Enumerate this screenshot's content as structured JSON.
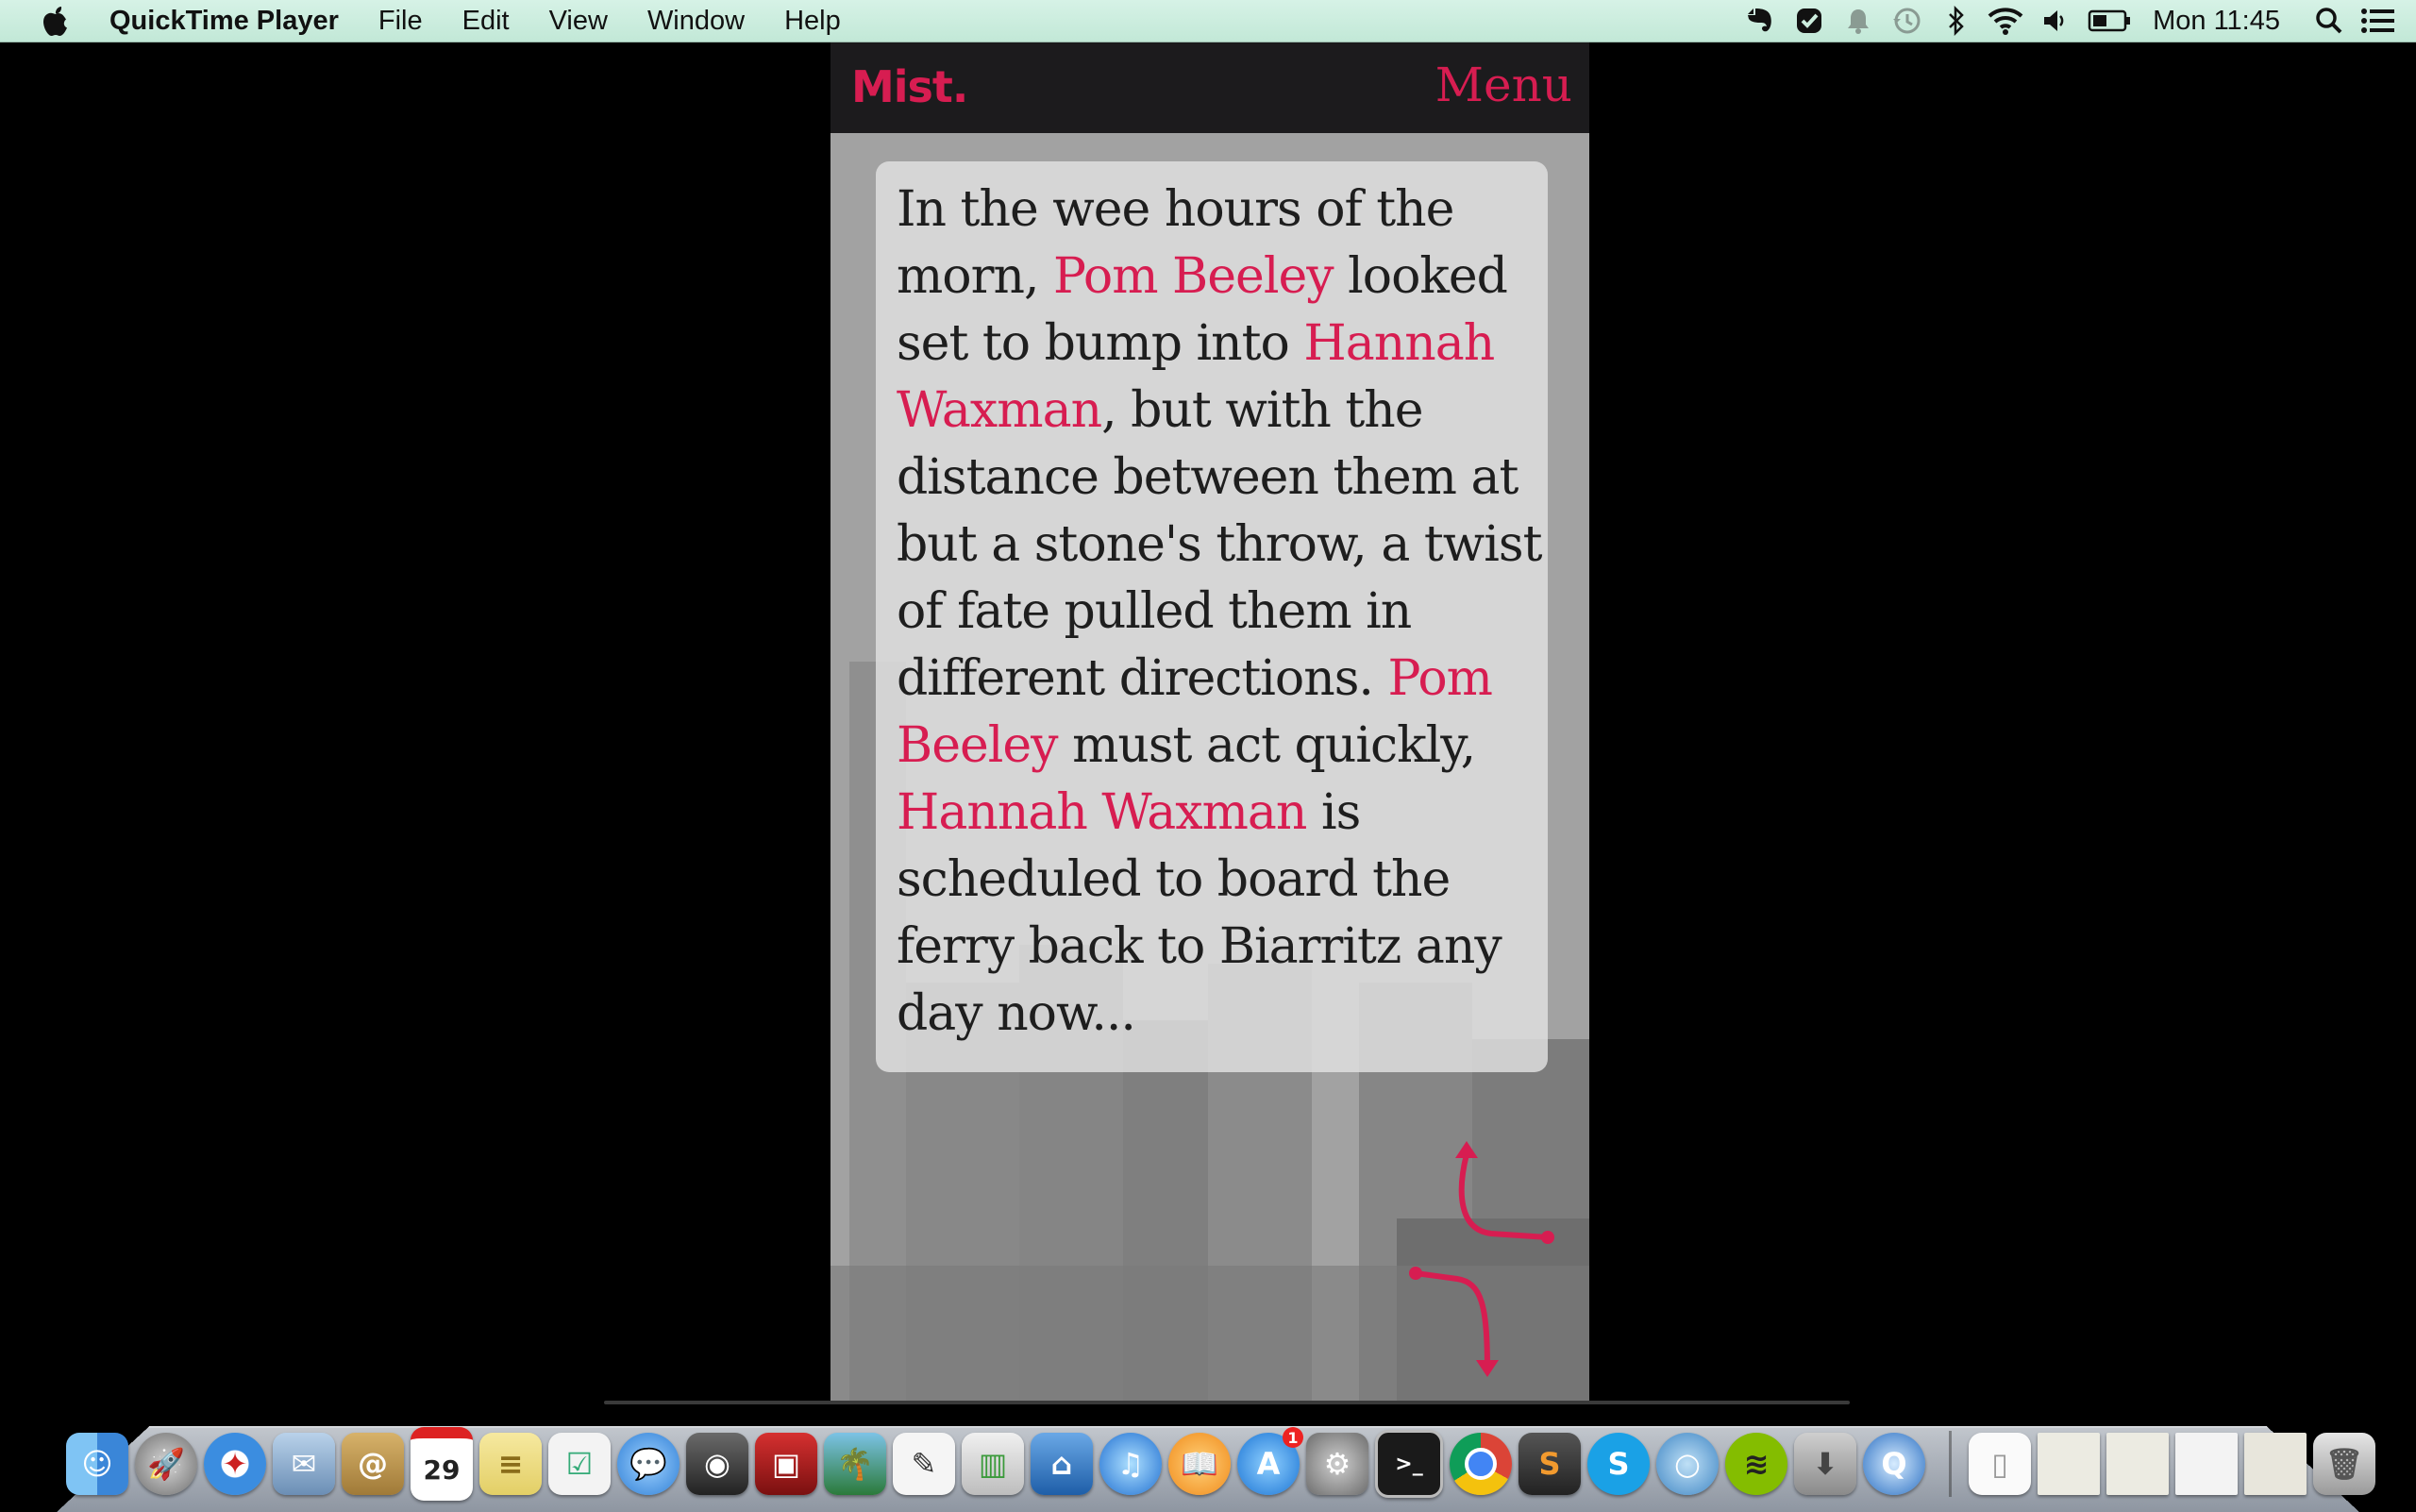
{
  "menubar": {
    "apple_icon": "apple-logo-icon",
    "app_name": "QuickTime Player",
    "menus": [
      "File",
      "Edit",
      "View",
      "Window",
      "Help"
    ],
    "status_icons": [
      "evernote-icon",
      "checkmark-badge-icon",
      "notification-bell-icon",
      "time-machine-icon",
      "bluetooth-icon",
      "wifi-icon",
      "volume-icon",
      "battery-icon"
    ],
    "clock": "Mon 11:45",
    "spotlight_icon": "search-icon",
    "notification_center_icon": "list-icon"
  },
  "app": {
    "brand": "Mist.",
    "menu_label": "Menu",
    "story": {
      "t1": "In the wee hours of the morn, ",
      "n1": "Pom Beeley",
      "t2": " looked set to bump into ",
      "n2": "Hannah Waxman",
      "t3": ", but with the distance between them at but a stone's throw, a twist of fate pulled them in different directions. ",
      "n3": "Pom Beeley",
      "t4": " must act quickly, ",
      "n4": "Hannah Waxman",
      "t5": " is scheduled to board the ferry back to Biarritz any day now..."
    },
    "nav_icon": "branching-arrows-icon"
  },
  "dock": {
    "calendar_day": "29",
    "app_store_badge": "1",
    "items": [
      "finder",
      "launchpad",
      "safari",
      "mail",
      "contacts",
      "calendar",
      "notes",
      "reminders",
      "messages",
      "facetime",
      "photo-booth",
      "iphoto",
      "textedit",
      "numbers",
      "keynote",
      "itunes",
      "ibooks",
      "app-store",
      "system-preferences",
      "terminal",
      "chrome",
      "sublime-text",
      "skype",
      "chat",
      "spotify",
      "downloads",
      "quicktime"
    ],
    "right_items": [
      "document",
      "window-1",
      "window-2",
      "window-3",
      "window-4",
      "trash"
    ]
  },
  "colors": {
    "accent": "#d71d51",
    "menubar_bg": "#cdeedf",
    "app_header_bg": "#1c1b1d"
  }
}
